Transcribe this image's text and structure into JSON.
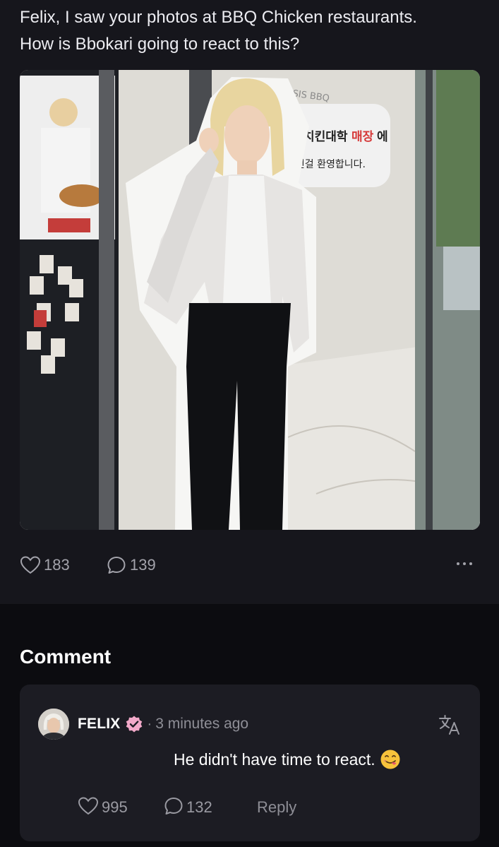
{
  "post": {
    "text_line1": "Felix, I saw your photos at BBQ Chicken restaurants.",
    "text_line2": "How is Bbokari going to react to this?",
    "image": {
      "sign_brand": "bbq",
      "sign_line1_a": "치킨대학",
      "sign_line1_b": "매장",
      "sign_line1_c": "에",
      "sign_line2": "오신걸 환영합니다.",
      "glass_text": "ESIS BBQ"
    },
    "like_count": "183",
    "comment_count": "139",
    "more_icon": "ellipsis-icon"
  },
  "comments_section": {
    "title": "Comment",
    "comment": {
      "author": "FELIX",
      "time": "3 minutes ago",
      "separator": "·",
      "body": "He didn't have time to react.",
      "emoji": "face-savoring-food-icon",
      "like_count": "995",
      "reply_count": "132",
      "reply_label": "Reply"
    }
  },
  "colors": {
    "background": "#0c0c10",
    "card": "#1c1c23",
    "verified": "#f2a9c9",
    "muted": "#a3a3ab"
  }
}
